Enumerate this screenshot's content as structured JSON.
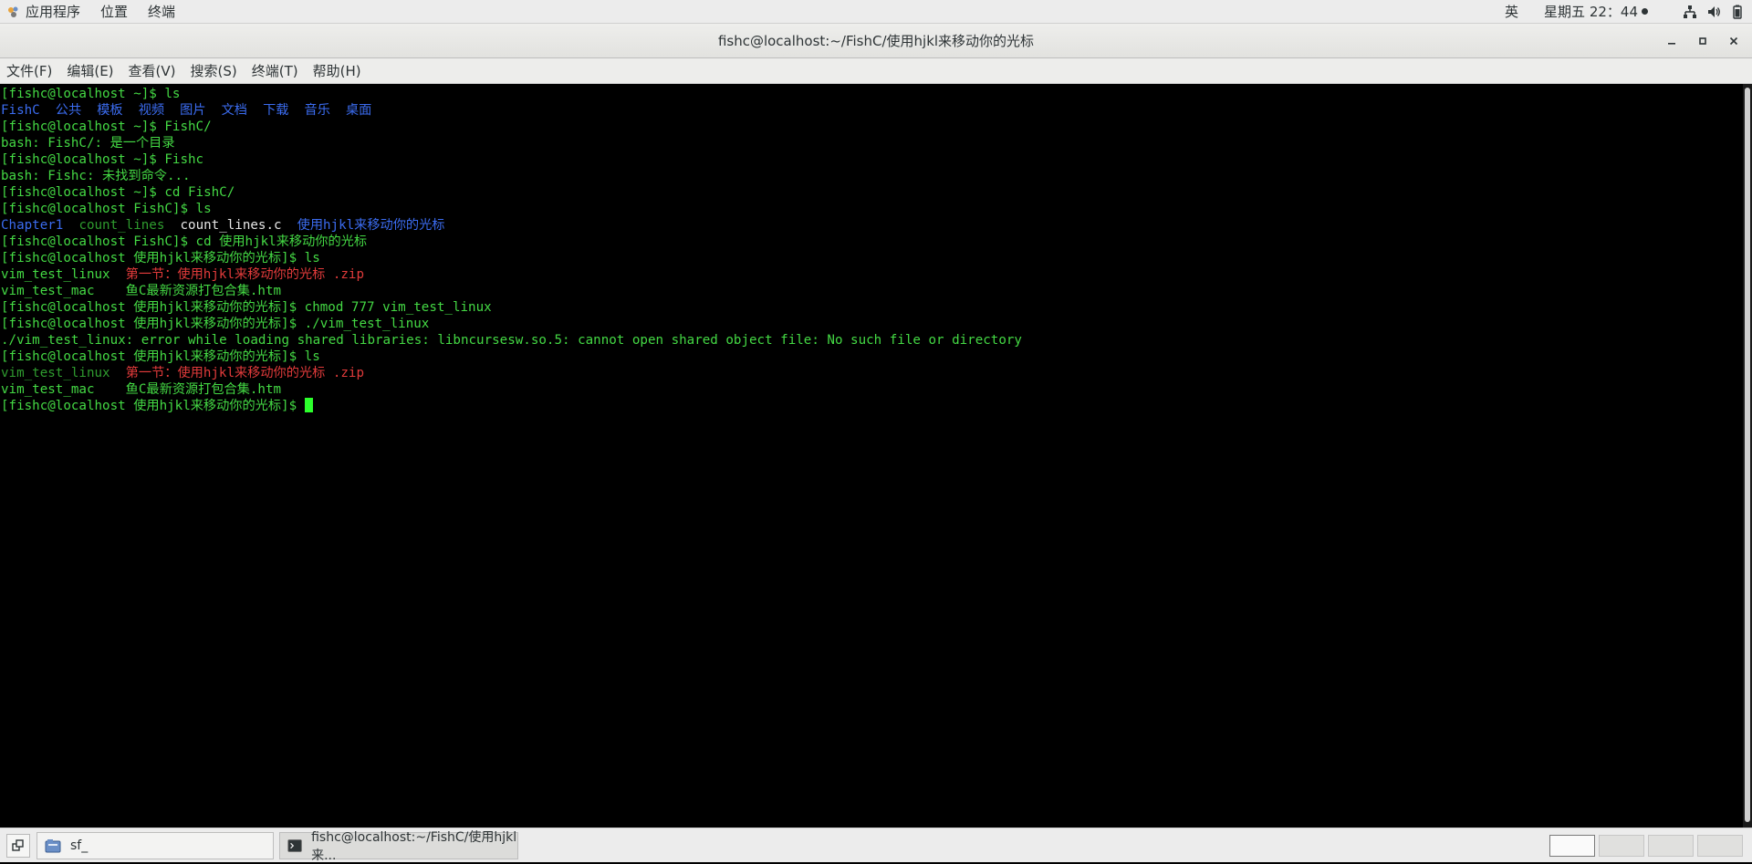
{
  "topbar": {
    "applications": "应用程序",
    "places": "位置",
    "terminal": "终端",
    "ime": "英",
    "clock": "星期五 22：44"
  },
  "window": {
    "title": "fishc@localhost:~/FishC/使用hjkl来移动你的光标"
  },
  "menu": [
    "文件(F)",
    "编辑(E)",
    "查看(V)",
    "搜索(S)",
    "终端(T)",
    "帮助(H)"
  ],
  "terminal_lines": [
    [
      {
        "t": "[fishc@localhost ~]$ ls",
        "c": "green"
      }
    ],
    [
      {
        "t": "FishC  公共  模板  视频  图片  文档  下载  音乐  桌面",
        "c": "blue"
      }
    ],
    [
      {
        "t": "[fishc@localhost ~]$ FishC/",
        "c": "green"
      }
    ],
    [
      {
        "t": "bash: FishC/: 是一个目录",
        "c": "green"
      }
    ],
    [
      {
        "t": "[fishc@localhost ~]$ Fishc",
        "c": "green"
      }
    ],
    [
      {
        "t": "bash: Fishc: 未找到命令...",
        "c": "green"
      }
    ],
    [
      {
        "t": "[fishc@localhost ~]$ cd FishC/",
        "c": "green"
      }
    ],
    [
      {
        "t": "[fishc@localhost FishC]$ ls",
        "c": "green"
      }
    ],
    [
      {
        "t": "Chapter1",
        "c": "blue"
      },
      {
        "t": "  ",
        "c": "green"
      },
      {
        "t": "count_lines",
        "c": "dkgreen"
      },
      {
        "t": "  ",
        "c": "green"
      },
      {
        "t": "count_lines.c",
        "c": "white"
      },
      {
        "t": "  ",
        "c": "green"
      },
      {
        "t": "使用hjkl来移动你的光标",
        "c": "blue"
      }
    ],
    [
      {
        "t": "[fishc@localhost FishC]$ cd 使用hjkl来移动你的光标",
        "c": "green"
      }
    ],
    [
      {
        "t": "[fishc@localhost 使用hjkl来移动你的光标]$ ls",
        "c": "green"
      }
    ],
    [
      {
        "t": "vim_test_linux  ",
        "c": "green"
      },
      {
        "t": "第一节：使用hjkl来移动你的光标 .zip",
        "c": "red"
      }
    ],
    [
      {
        "t": "vim_test_mac    鱼C最新资源打包合集.htm",
        "c": "green"
      }
    ],
    [
      {
        "t": "[fishc@localhost 使用hjkl来移动你的光标]$ chmod 777 vim_test_linux",
        "c": "green"
      }
    ],
    [
      {
        "t": "[fishc@localhost 使用hjkl来移动你的光标]$ ./vim_test_linux",
        "c": "green"
      }
    ],
    [
      {
        "t": "./vim_test_linux: error while loading shared libraries: libncursesw.so.5: cannot open shared object file: No such file or directory",
        "c": "green"
      }
    ],
    [
      {
        "t": "[fishc@localhost 使用hjkl来移动你的光标]$ ls",
        "c": "green"
      }
    ],
    [
      {
        "t": "vim_test_linux",
        "c": "dkgreen"
      },
      {
        "t": "  ",
        "c": "green"
      },
      {
        "t": "第一节：使用hjkl来移动你的光标 .zip",
        "c": "red"
      }
    ],
    [
      {
        "t": "vim_test_mac    鱼C最新资源打包合集.htm",
        "c": "green"
      }
    ],
    [
      {
        "t": "[fishc@localhost 使用hjkl来移动你的光标]$ ",
        "c": "green"
      }
    ]
  ],
  "taskbar": {
    "tasks": [
      {
        "label": "sf_",
        "active": false,
        "icon": "folder-icon"
      },
      {
        "label": "fishc@localhost:~/FishC/使用hjkl来...",
        "active": true,
        "icon": "terminal-icon"
      }
    ],
    "workspaces": 4,
    "current_workspace": 1
  }
}
